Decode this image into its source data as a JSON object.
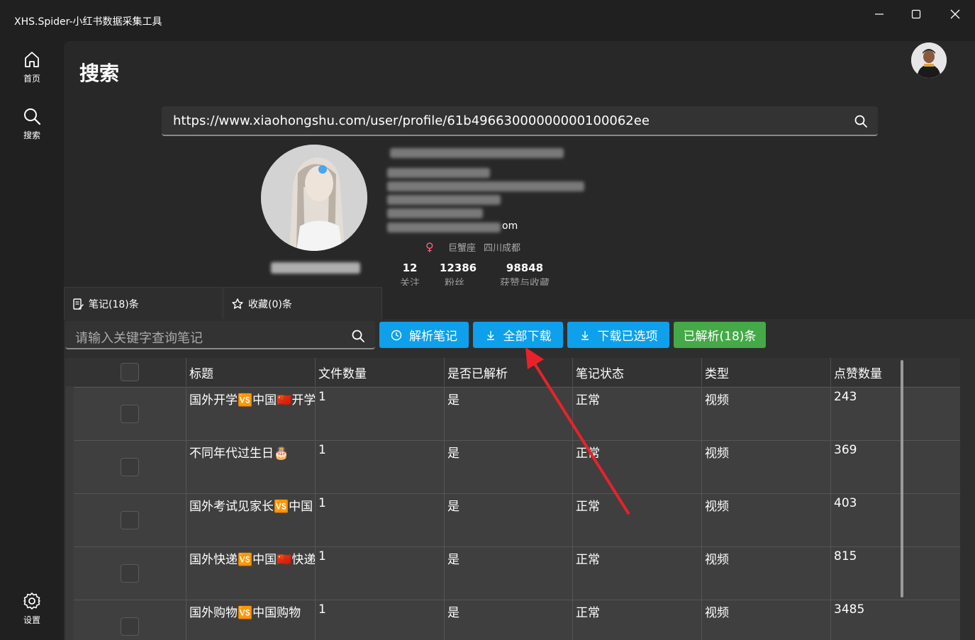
{
  "window": {
    "title": "XHS.Spider-小红书数据采集工具"
  },
  "sidebar": {
    "items": [
      {
        "label": "首页",
        "icon": "home-icon"
      },
      {
        "label": "搜索",
        "icon": "search-icon"
      }
    ],
    "settings": {
      "label": "设置",
      "icon": "gear-icon"
    }
  },
  "page": {
    "title": "搜索"
  },
  "search": {
    "value": "https://www.xiaohongshu.com/user/profile/61b49663000000000100062ee"
  },
  "profile": {
    "email_tail": "om",
    "zodiac": "巨蟹座",
    "location": "四川成都",
    "stats": [
      {
        "value": "12",
        "label": "关注"
      },
      {
        "value": "12386",
        "label": "粉丝"
      },
      {
        "value": "98848",
        "label": "获赞与收藏"
      }
    ]
  },
  "tabs": [
    {
      "label": "笔记(18)条"
    },
    {
      "label": "收藏(0)条"
    }
  ],
  "notes_filter": {
    "placeholder": "请输入关键字查询笔记"
  },
  "toolbar": {
    "parse_label": "解析笔记",
    "download_all_label": "全部下载",
    "download_selected_label": "下载已选项",
    "parsed_count_label": "已解析(18)条"
  },
  "table": {
    "headers": [
      "标题",
      "文件数量",
      "是否已解析",
      "笔记状态",
      "类型",
      "点赞数量"
    ],
    "rows": [
      {
        "title": "国外开学🆚中国🇨🇳开学",
        "files": "1",
        "parsed": "是",
        "status": "正常",
        "type": "视频",
        "likes": "243"
      },
      {
        "title": "不同年代过生日🎂",
        "files": "1",
        "parsed": "是",
        "status": "正常",
        "type": "视频",
        "likes": "369"
      },
      {
        "title": "国外考试见家长🆚中国",
        "files": "1",
        "parsed": "是",
        "status": "正常",
        "type": "视频",
        "likes": "403"
      },
      {
        "title": "国外快递🆚中国🇨🇳快递",
        "files": "1",
        "parsed": "是",
        "status": "正常",
        "type": "视频",
        "likes": "815"
      },
      {
        "title": "国外购物🆚中国购物",
        "files": "1",
        "parsed": "是",
        "status": "正常",
        "type": "视频",
        "likes": "3485"
      }
    ]
  },
  "colors": {
    "accent": "#0ea0ea",
    "success": "#45a948",
    "annotation": "#e8222a"
  }
}
